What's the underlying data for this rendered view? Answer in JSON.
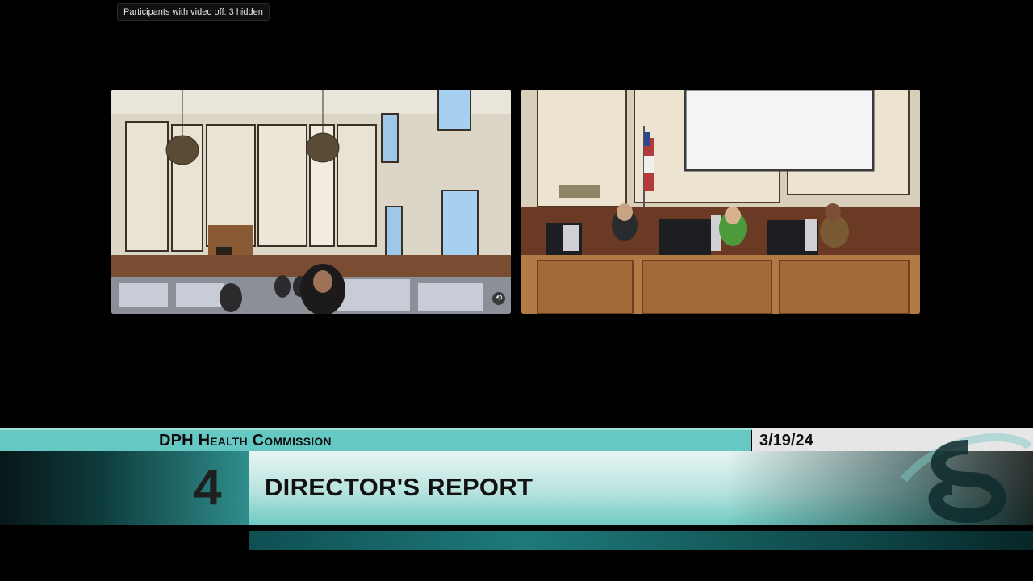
{
  "meeting_overlay": {
    "hidden_participants": "Participants with video off: 3 hidden"
  },
  "tiles": [
    {
      "name": "audience-room-feed",
      "icon": "camera-switch-icon"
    },
    {
      "name": "commission-dais-feed",
      "icon": "none"
    }
  ],
  "lower_third": {
    "organization": "DPH Health Commission",
    "date": "3/19/24",
    "item_number": "4",
    "item_title": "DIRECTOR'S REPORT",
    "logo": "sfgovtv-logo-icon"
  },
  "colors": {
    "accent_teal": "#66c8c2",
    "background": "#000000",
    "date_box": "#e6e6e6"
  }
}
